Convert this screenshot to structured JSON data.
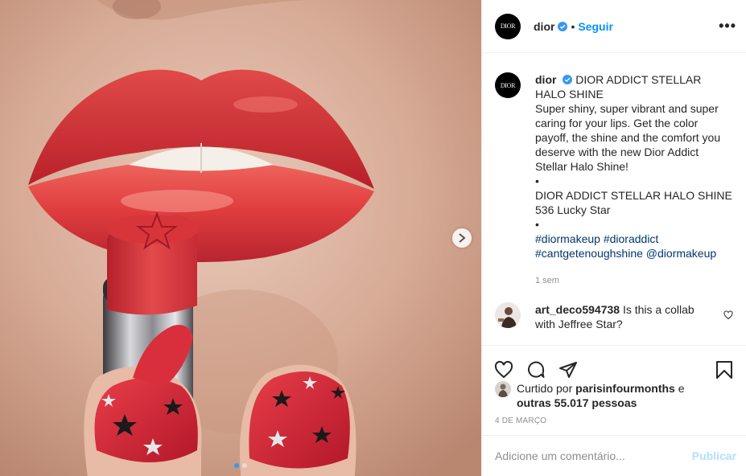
{
  "post": {
    "account": "dior",
    "avatar_label": "DIOR",
    "follow_label": "Seguir",
    "separator": "•",
    "more_label": "•••",
    "caption": {
      "headline": "DIOR ADDICT STELLAR HALO SHINE",
      "line1": "Super shiny, super vibrant and super caring for your lips. Get the color payoff, the shine and the comfort you deserve with the new Dior Addict Stellar Halo Shine!",
      "bullet1": "•",
      "line2": "DIOR ADDICT STELLAR HALO SHINE",
      "line3": "536 Lucky Star",
      "bullet2": "•",
      "tag1": "#diormakeup",
      "tag2": "#dioraddict",
      "tag3": "#cantgetenoughshine",
      "tag4": "@diormakeup",
      "age": "1 sem"
    },
    "comment": {
      "user": "art_deco594738",
      "text": "Is this a collab with Jeffree Star?"
    },
    "likes": {
      "prefix": "Curtido por",
      "user": "parisinfourmonths",
      "conj": "e",
      "others": "outras 55.017 pessoas"
    },
    "date": "4 DE MARÇO",
    "add_comment": {
      "placeholder": "Adicione um comentário...",
      "publish_label": "Publicar"
    },
    "carousel": {
      "slides": 2,
      "active": 1
    },
    "colors": {
      "accent": "#0095f6",
      "lipstick": "#d93036",
      "muted": "#8e8e8e"
    },
    "icons": [
      "verified-icon",
      "more-icon",
      "heart-icon",
      "comment-icon",
      "share-icon",
      "save-icon",
      "next-arrow-icon"
    ]
  }
}
